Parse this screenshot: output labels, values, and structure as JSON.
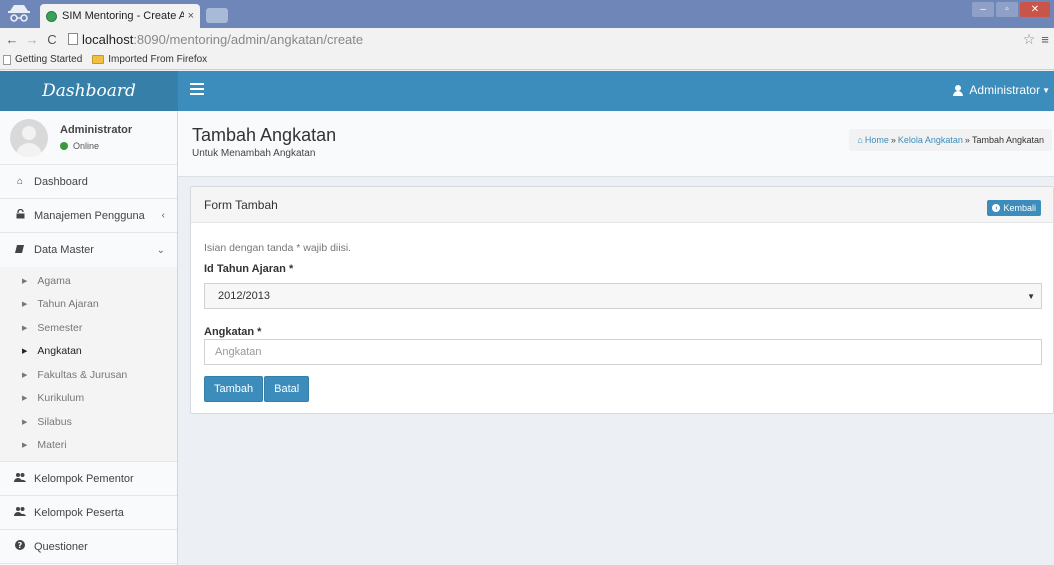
{
  "browser": {
    "tab_title": "SIM Mentoring - Create Angk",
    "tab_close": "×",
    "url_host": "localhost",
    "url_path": ":8090/mentoring/admin/angkatan/create",
    "bookmarks": [
      "Getting Started",
      "Imported From Firefox"
    ]
  },
  "header": {
    "logo": "Dashboard",
    "user_menu": "Administrator"
  },
  "sidebar": {
    "user_name": "Administrator",
    "user_status": "Online",
    "items": [
      {
        "label": "Dashboard",
        "icon": "home-icon"
      },
      {
        "label": "Manajemen Pengguna",
        "icon": "lock-icon"
      },
      {
        "label": "Data Master",
        "icon": "book-icon"
      },
      {
        "label": "Kelompok Pementor",
        "icon": "users-icon"
      },
      {
        "label": "Kelompok Peserta",
        "icon": "users-icon"
      },
      {
        "label": "Questioner",
        "icon": "question-circle-icon"
      }
    ],
    "data_master_sub": [
      "Agama",
      "Tahun Ajaran",
      "Semester",
      "Angkatan",
      "Fakultas & Jurusan",
      "Kurikulum",
      "Silabus",
      "Materi"
    ],
    "active_sub": "Angkatan"
  },
  "content": {
    "title": "Tambah Angkatan",
    "subtitle": "Untuk Menambah Angkatan",
    "breadcrumb": [
      "Home",
      "Kelola Angkatan",
      "Tambah Angkatan"
    ]
  },
  "form": {
    "box_title": "Form Tambah",
    "back_label": "Kembali",
    "note": "Isian dengan tanda * wajib diisi.",
    "field1_label": "Id Tahun Ajaran *",
    "field1_value": "2012/2013",
    "field2_label": "Angkatan *",
    "field2_placeholder": "Angkatan",
    "submit_label": "Tambah",
    "cancel_label": "Batal"
  },
  "colors": {
    "primary": "#3c8dbc",
    "logo_bg": "#367fa9",
    "online": "#3c9a3c"
  }
}
